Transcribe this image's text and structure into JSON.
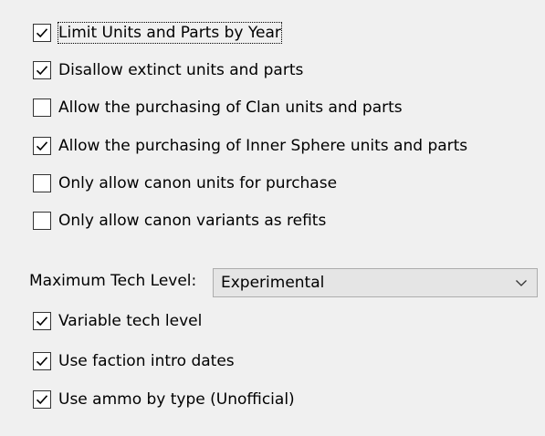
{
  "options": [
    {
      "label": "Limit Units and Parts by Year",
      "checked": true,
      "focused": true
    },
    {
      "label": "Disallow extinct units and parts",
      "checked": true
    },
    {
      "label": "Allow the purchasing of Clan units and parts",
      "checked": false
    },
    {
      "label": "Allow the purchasing of Inner Sphere units and parts",
      "checked": true
    },
    {
      "label": "Only allow canon units for purchase",
      "checked": false
    },
    {
      "label": "Only allow canon variants as refits",
      "checked": false
    }
  ],
  "tech_level": {
    "label": "Maximum Tech Level:",
    "value": "Experimental",
    "dropdown_icon": "chevron-down-icon"
  },
  "options_after": [
    {
      "label": "Variable tech level",
      "checked": true
    },
    {
      "label": "Use faction intro dates",
      "checked": true
    },
    {
      "label": "Use ammo by type (Unofficial)",
      "checked": true
    }
  ],
  "colors": {
    "background": "#f0f0f0",
    "checkbox_border": "#333333",
    "checkmark": "#000000",
    "combo_background": "#e5e5e5",
    "combo_border": "#adadad"
  }
}
